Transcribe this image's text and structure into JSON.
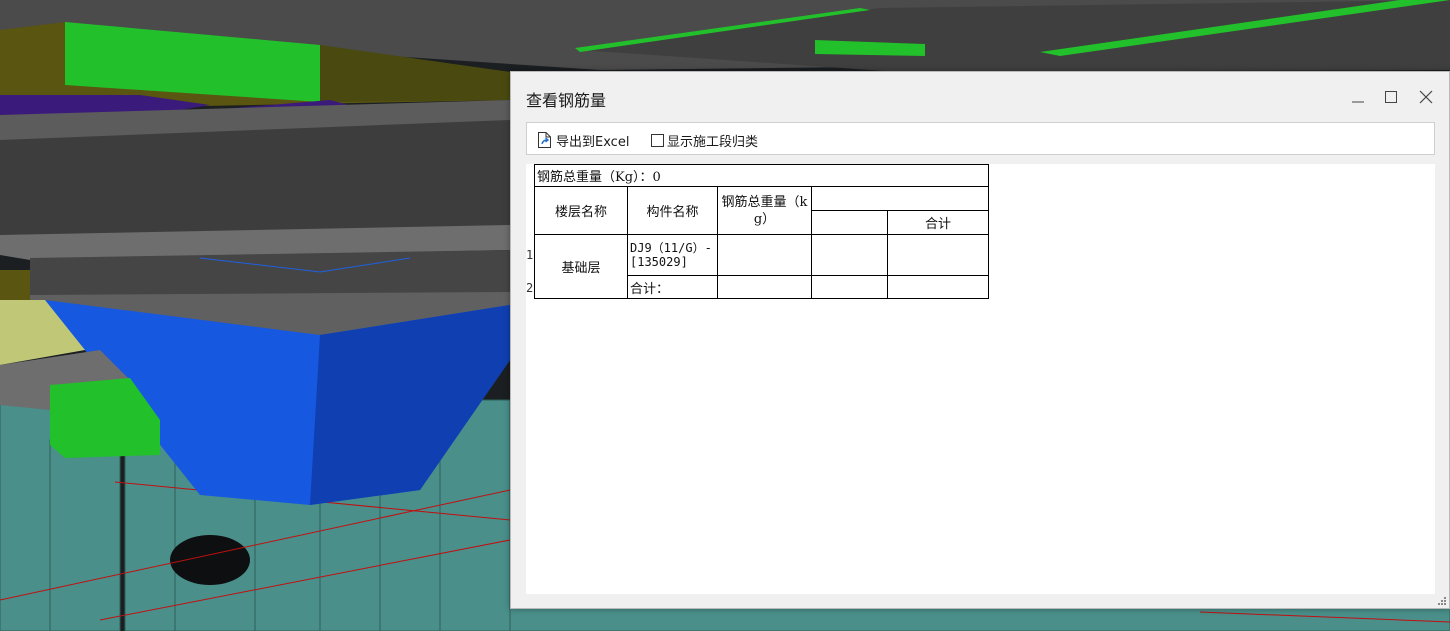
{
  "dialog": {
    "title": "查看钢筋量",
    "controls": {
      "minimize": "minimize-icon",
      "maximize": "maximize-icon",
      "close": "close-icon"
    }
  },
  "toolbar": {
    "export_icon": "export-file-icon",
    "export_label": "导出到Excel",
    "show_stage_label": "显示施工段归类",
    "show_stage_checked": false
  },
  "report": {
    "total_label": "钢筋总重量（Kg）：0",
    "headers": {
      "floor": "楼层名称",
      "component": "构件名称",
      "total_weight": "钢筋总重量（kg）",
      "subtotal": "合计"
    },
    "rows": [
      {
        "row_num": "1",
        "floor": "基础层",
        "component": "DJ9（11/G）-[135029]",
        "weight": "",
        "col4": "",
        "col5": ""
      },
      {
        "row_num": "2",
        "floor": "",
        "component": "合计：",
        "weight": "",
        "col4": "",
        "col5": ""
      }
    ]
  },
  "colors": {
    "slab": "#4a4a4a",
    "beam_green": "#22c02a",
    "column_teal": "#4a8f8a",
    "footing_blue": "#1658e0",
    "olive": "#5a5510",
    "purple": "#3a1a7a",
    "grid_red": "#c01010"
  }
}
